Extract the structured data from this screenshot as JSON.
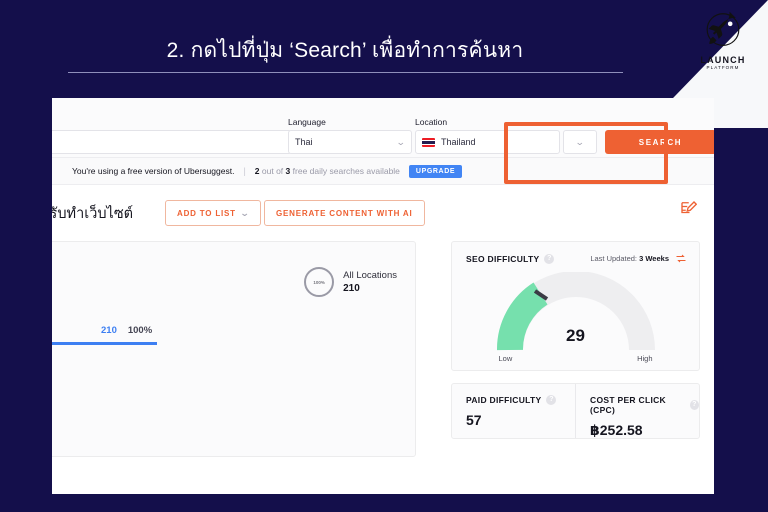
{
  "slide": {
    "title": "2. กดไปที่ปุ่ม ‘Search’ เพื่อทำการค้นหา",
    "background_color": "#140f4b",
    "accent_color": "#ee6133"
  },
  "logo": {
    "icon": "rocket-icon",
    "wordmark": "LAUNCH",
    "sub": "PLATFORM"
  },
  "app": {
    "searchbar": {
      "keyword_value": "",
      "keyword_placeholder": "",
      "language_label": "Language",
      "language_value": "Thai",
      "location_label": "Location",
      "location_value": "Thailand",
      "location_flag": "flag-thailand",
      "search_button": "SEARCH",
      "highlight_color": "#ee6133"
    },
    "notice": {
      "message": "You're using a free version of Ubersuggest.",
      "separator": "|",
      "quota_used": "2",
      "quota_mid": "out of",
      "quota_total": "3",
      "quota_tail": "free daily searches available",
      "upgrade_label": "UPGRADE",
      "upgrade_color": "#4285f4"
    },
    "keyword_row": {
      "keyword_text": "ัทรับทำเว็บไซต์",
      "add_to_list": "ADD TO LIST",
      "generate_ai": "GENERATE CONTENT WITH AI",
      "edit_icon": "edit-note-icon"
    },
    "volume_panel": {
      "donut_label": "100%",
      "location_name": "All Locations",
      "location_value": "210",
      "legend_value": "210",
      "legend_percent": "100%"
    },
    "seo_difficulty": {
      "title": "SEO DIFFICULTY",
      "help_icon": "question-mark-icon",
      "updated_label": "Last Updated:",
      "updated_value": "3 Weeks",
      "refresh_icon": "refresh-icon",
      "value": "29",
      "low_label": "Low",
      "high_label": "High"
    },
    "metrics": [
      {
        "title": "PAID DIFFICULTY",
        "help_icon": "question-mark-icon",
        "value": "57"
      },
      {
        "title": "COST PER CLICK (CPC)",
        "help_icon": "question-mark-icon",
        "value": "฿252.58"
      }
    ]
  },
  "chart_data": {
    "type": "bar",
    "title": "SEO Difficulty Gauge",
    "gauge": {
      "value": 29,
      "min": 0,
      "max": 100,
      "low_label": "Low",
      "high_label": "High",
      "filled_color": "#76e0ad",
      "track_color": "#eeeef0"
    },
    "volume": {
      "categories": [
        "All Locations"
      ],
      "values": [
        210
      ],
      "percent": [
        100
      ]
    },
    "metrics": {
      "categories": [
        "Paid Difficulty",
        "Cost Per Click (CPC)"
      ],
      "values": [
        57,
        252.58
      ]
    }
  }
}
